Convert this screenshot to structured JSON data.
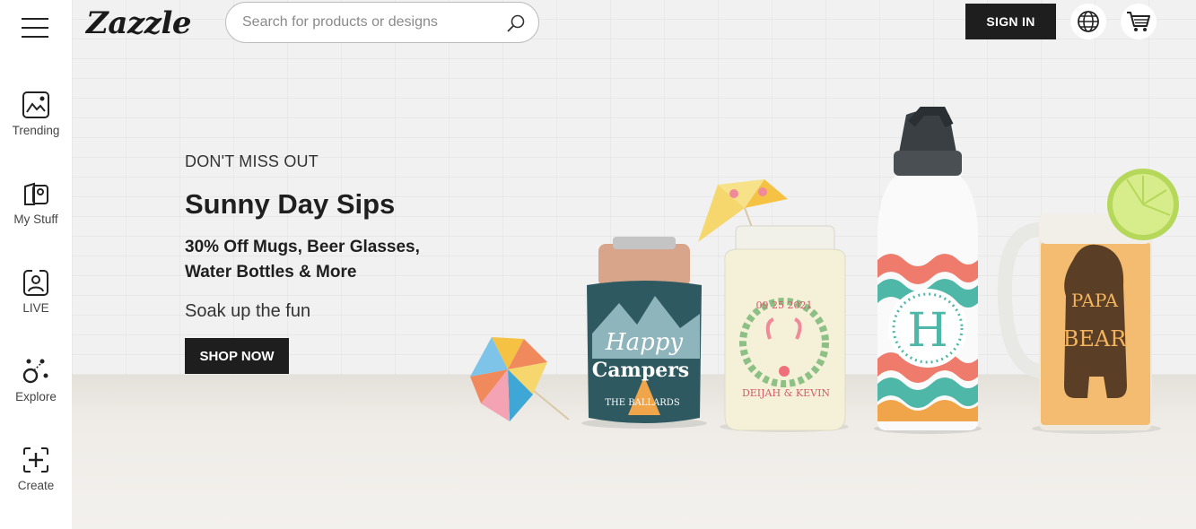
{
  "brand": {
    "logo_text": "Zazzle"
  },
  "search": {
    "placeholder": "Search for products or designs"
  },
  "header": {
    "sign_in_label": "SIGN IN"
  },
  "sidebar": {
    "items": [
      {
        "label": "Trending",
        "icon": "trending-icon"
      },
      {
        "label": "My Stuff",
        "icon": "my-stuff-icon"
      },
      {
        "label": "LIVE",
        "icon": "live-icon"
      },
      {
        "label": "Explore",
        "icon": "explore-icon"
      },
      {
        "label": "Create",
        "icon": "create-icon"
      }
    ]
  },
  "hero": {
    "eyebrow": "DON'T MISS OUT",
    "headline": "Sunny Day Sips",
    "offer": "30% Off Mugs, Beer Glasses, Water Bottles & More",
    "tagline": "Soak up the fun",
    "cta_label": "SHOP NOW",
    "products": {
      "koozie_line1": "Happy",
      "koozie_line2": "Campers",
      "koozie_line3": "THE BALLARDS",
      "jar_date": "09 25 2021",
      "jar_names": "DEIJAH & KEVIN",
      "bottle_monogram": "H",
      "stein_line1": "PAPA",
      "stein_line2": "BEAR"
    }
  },
  "colors": {
    "button_dark": "#1e1e1e",
    "coral": "#ee7b6b",
    "teal": "#4fb7a8",
    "orange": "#f0a54a"
  }
}
